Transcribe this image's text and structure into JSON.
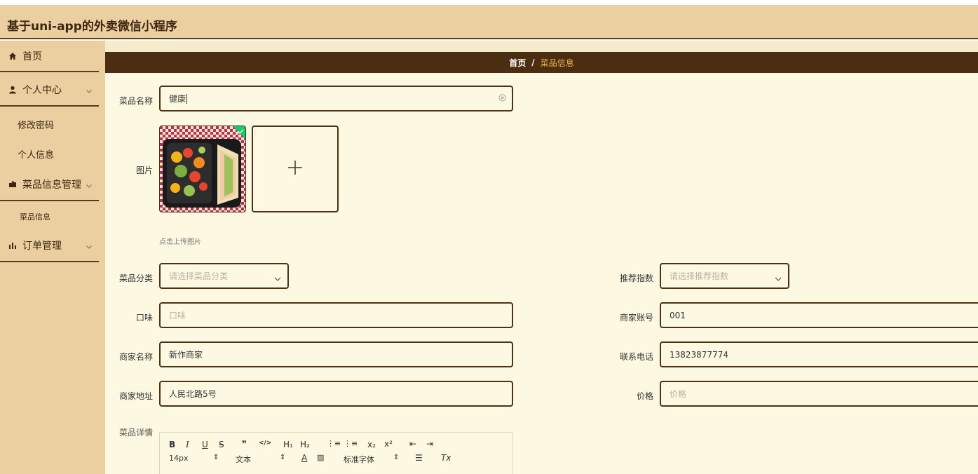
{
  "app": {
    "title": "基于uni-app的外卖微信小程序"
  },
  "sidebar": {
    "items": [
      {
        "label": "首页",
        "icon": "home-icon"
      },
      {
        "label": "个人中心",
        "icon": "user-icon"
      },
      {
        "label": "修改密码"
      },
      {
        "label": "个人信息"
      },
      {
        "label": "菜品信息管理",
        "icon": "folder-icon"
      },
      {
        "label": "菜品信息"
      },
      {
        "label": "订单管理",
        "icon": "bar-chart-icon"
      }
    ]
  },
  "breadcrumb": {
    "home": "首页",
    "separator": "/",
    "current": "菜品信息"
  },
  "form": {
    "dish_name": {
      "label": "菜品名称",
      "value": "健康"
    },
    "image": {
      "label": "图片",
      "tip": "点击上传图片"
    },
    "category": {
      "label": "菜品分类",
      "placeholder": "请选择菜品分类"
    },
    "recommend": {
      "label": "推荐指数",
      "placeholder": "请选择推荐指数"
    },
    "taste": {
      "label": "口味",
      "placeholder": "口味"
    },
    "merchant_account": {
      "label": "商家账号",
      "value": "001"
    },
    "merchant_name": {
      "label": "商家名称",
      "value": "新作商家"
    },
    "phone": {
      "label": "联系电话",
      "value": "13823877774"
    },
    "merchant_address": {
      "label": "商家地址",
      "value": "人民北路5号"
    },
    "price": {
      "label": "价格",
      "placeholder": "价格"
    },
    "detail": {
      "label": "菜品详情"
    }
  },
  "editor": {
    "bold": "B",
    "italic": "I",
    "underline": "U",
    "strike": "S",
    "quote": "❞",
    "code": "</>",
    "h1": "H₁",
    "h2": "H₂",
    "ordered_list": "⋮≡",
    "bullet_list": "⋮≡",
    "subscript": "x₂",
    "superscript": "x²",
    "outdent": "⇤",
    "indent": "⇥",
    "size": "14px",
    "format": "文本",
    "font": "标准字体",
    "font_color": "A",
    "clean": "Tx"
  },
  "colors": {
    "accent": "#4b2d12",
    "header_bg": "#ebcfa1",
    "content_bg": "#fcf8e1",
    "crumb_active": "#f2b84a",
    "success": "#13ce66"
  }
}
